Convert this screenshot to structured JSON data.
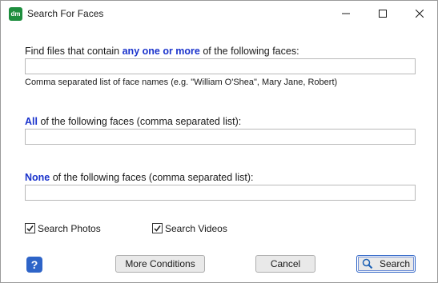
{
  "window": {
    "title": "Search For Faces",
    "app_icon_text": "dm"
  },
  "any_section": {
    "prefix": "Find files that contain ",
    "emphasis": "any one or more",
    "suffix": " of the following faces:",
    "value": "",
    "hint": "Comma separated list of face names (e.g. \"William O'Shea\", Mary Jane, Robert)"
  },
  "all_section": {
    "emphasis": "All",
    "suffix": " of the following faces (comma separated list):",
    "value": ""
  },
  "none_section": {
    "emphasis": "None",
    "suffix": " of the following faces (comma separated list):",
    "value": ""
  },
  "options": {
    "photos_label": "Search Photos",
    "photos_checked": true,
    "videos_label": "Search Videos",
    "videos_checked": true
  },
  "buttons": {
    "help_icon": "question-mark",
    "more_conditions": "More Conditions",
    "cancel": "Cancel",
    "search": "Search",
    "search_icon": "magnifier"
  },
  "colors": {
    "emphasis": "#1a33cc",
    "app_icon": "#1e8e3e",
    "help_icon": "#2e64c8"
  }
}
